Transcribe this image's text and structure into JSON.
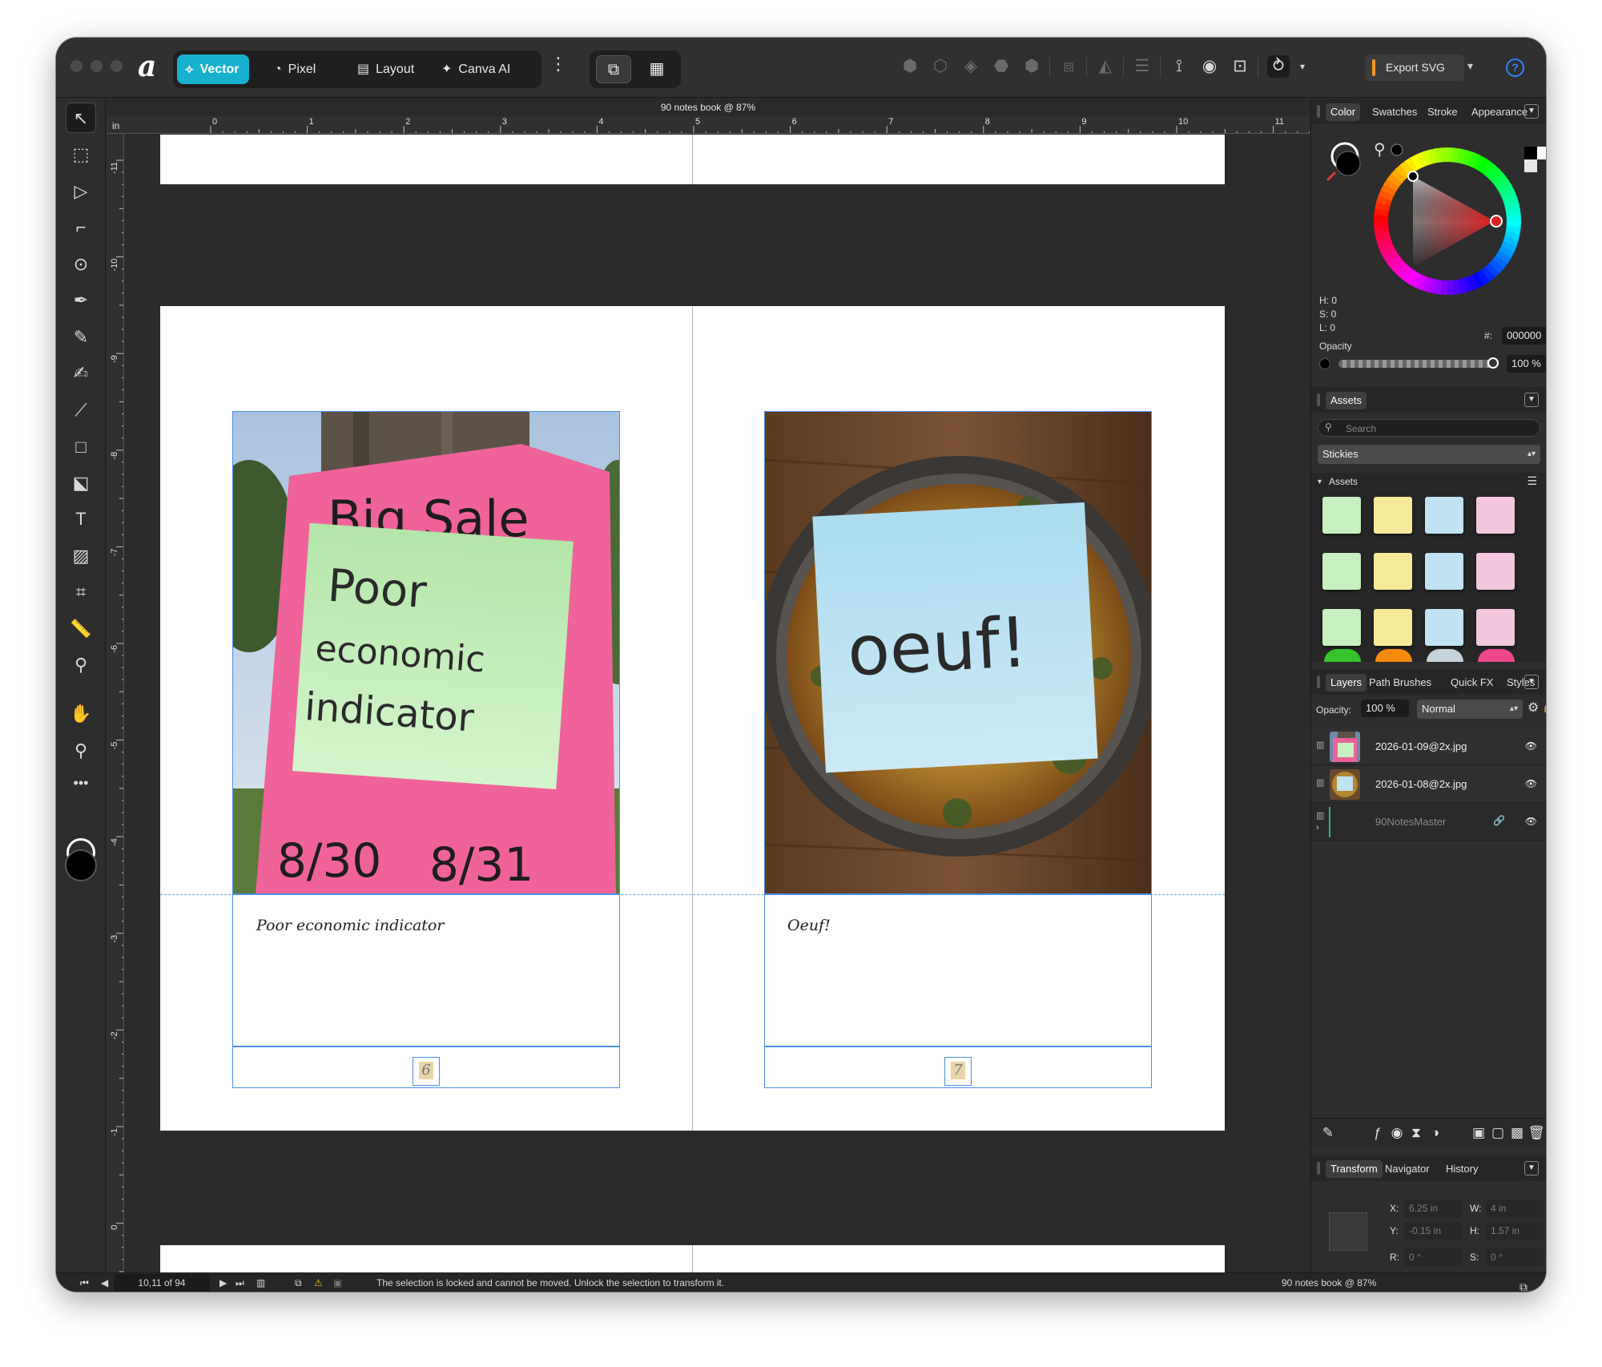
{
  "window": {
    "doc_title": "90 notes book @ 87%"
  },
  "personas": [
    {
      "label": "Vector",
      "icon": "vector-persona-icon",
      "active": true
    },
    {
      "label": "Pixel",
      "icon": "pixel-persona-icon",
      "active": false
    },
    {
      "label": "Layout",
      "icon": "layout-persona-icon",
      "active": false
    },
    {
      "label": "Canva AI",
      "icon": "canva-ai-icon",
      "active": false
    }
  ],
  "toolbar": {
    "export_label": "Export SVG",
    "help_label": "?"
  },
  "ruler": {
    "unit": "in",
    "h_labels": [
      "0",
      "1",
      "2",
      "3",
      "4",
      "5",
      "6",
      "7",
      "8",
      "9",
      "10",
      "11"
    ],
    "v_labels": [
      "-11",
      "-10",
      "-9",
      "-8",
      "-7",
      "-6",
      "-5",
      "-4",
      "-3",
      "-2",
      "-1",
      "0"
    ]
  },
  "spread": {
    "left": {
      "caption": "Poor economic indicator",
      "page_number": "6",
      "sign_title": "Big Sale",
      "sticky_text": [
        "Poor",
        "economic",
        "indicator"
      ],
      "sign_dates": [
        "8/30",
        "8/31"
      ],
      "sticky_color": "#c8f0c0"
    },
    "right": {
      "caption": "Oeuf!",
      "page_number": "7",
      "sticky_text": "oeuf!",
      "sticky_color": "#bde3f4"
    }
  },
  "status": {
    "page_indicator": "10,11 of 94",
    "message": "The selection is locked and cannot be moved. Unlock the selection to transform it.",
    "doc_title": "90 notes book @ 87%"
  },
  "color_panel": {
    "tabs": [
      "Color",
      "Swatches",
      "Stroke",
      "Appearance"
    ],
    "h": "H: 0",
    "s": "S: 0",
    "l": "L: 0",
    "hex_label": "#:",
    "hex": "000000",
    "opacity_label": "Opacity",
    "opacity": "100 %"
  },
  "assets_panel": {
    "tab": "Assets",
    "search_placeholder": "Search",
    "category": "Stickies",
    "section": "Assets",
    "swatch_colors": [
      "#c7efc0",
      "#f7e99a",
      "#bfe3f2",
      "#f3c6de"
    ],
    "dot_colors": [
      "#35c42a",
      "#f58a0a",
      "#c7d3da",
      "#f0478a"
    ]
  },
  "layers_panel": {
    "tabs": [
      "Layers",
      "Path Brushes",
      "Quick FX",
      "Styles"
    ],
    "opacity_label": "Opacity:",
    "opacity": "100 %",
    "blend_mode": "Normal",
    "layers": [
      {
        "name": "2026-01-09@2x.jpg"
      },
      {
        "name": "2026-01-08@2x.jpg"
      },
      {
        "name": "90NotesMaster"
      }
    ]
  },
  "transform_panel": {
    "tabs": [
      "Transform",
      "Navigator",
      "History"
    ],
    "x_label": "X:",
    "x": "6.25 in",
    "y_label": "Y:",
    "y": "-0.15 in",
    "w_label": "W:",
    "w": "4 in",
    "h_label": "H:",
    "h": "1.57 in",
    "r_label": "R:",
    "r": "0 °",
    "s_label": "S:",
    "s": "0 °"
  }
}
